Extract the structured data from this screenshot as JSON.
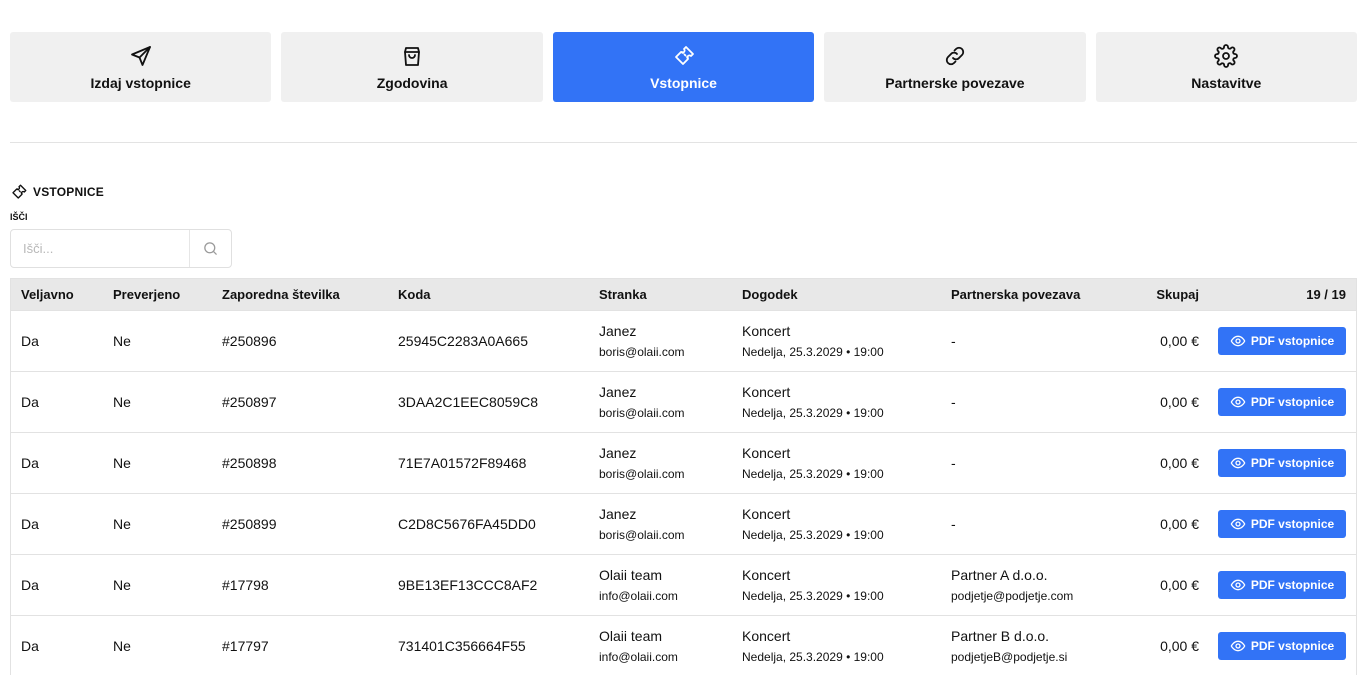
{
  "tabs": [
    {
      "label": "Izdaj vstopnice",
      "icon": "send-icon",
      "active": false
    },
    {
      "label": "Zgodovina",
      "icon": "shopping-bag-icon",
      "active": false
    },
    {
      "label": "Vstopnice",
      "icon": "ticket-icon",
      "active": true
    },
    {
      "label": "Partnerske povezave",
      "icon": "link-icon",
      "active": false
    },
    {
      "label": "Nastavitve",
      "icon": "gear-icon",
      "active": false
    }
  ],
  "section": {
    "title": "VSTOPNICE",
    "icon": "ticket-icon"
  },
  "search": {
    "label": "IŠČI",
    "placeholder": "Išči...",
    "value": "",
    "icon": "search-icon"
  },
  "table": {
    "headers": {
      "veljavno": "Veljavno",
      "preverjeno": "Preverjeno",
      "zaporedna": "Zaporedna številka",
      "koda": "Koda",
      "stranka": "Stranka",
      "dogodek": "Dogodek",
      "partnerska": "Partnerska povezava",
      "skupaj": "Skupaj",
      "count": "19 / 19"
    },
    "action_label": "PDF vstopnice",
    "action_icon": "eye-icon",
    "rows": [
      {
        "veljavno": "Da",
        "preverjeno": "Ne",
        "zaporedna": "#250896",
        "koda": "25945C2283A0A665",
        "stranka_name": "Janez",
        "stranka_email": "boris@olaii.com",
        "dogodek_name": "Koncert",
        "dogodek_date": "Nedelja, 25.3.2029 • 19:00",
        "partner_name": "-",
        "partner_email": "",
        "skupaj": "0,00 €"
      },
      {
        "veljavno": "Da",
        "preverjeno": "Ne",
        "zaporedna": "#250897",
        "koda": "3DAA2C1EEC8059C8",
        "stranka_name": "Janez",
        "stranka_email": "boris@olaii.com",
        "dogodek_name": "Koncert",
        "dogodek_date": "Nedelja, 25.3.2029 • 19:00",
        "partner_name": "-",
        "partner_email": "",
        "skupaj": "0,00 €"
      },
      {
        "veljavno": "Da",
        "preverjeno": "Ne",
        "zaporedna": "#250898",
        "koda": "71E7A01572F89468",
        "stranka_name": "Janez",
        "stranka_email": "boris@olaii.com",
        "dogodek_name": "Koncert",
        "dogodek_date": "Nedelja, 25.3.2029 • 19:00",
        "partner_name": "-",
        "partner_email": "",
        "skupaj": "0,00 €"
      },
      {
        "veljavno": "Da",
        "preverjeno": "Ne",
        "zaporedna": "#250899",
        "koda": "C2D8C5676FA45DD0",
        "stranka_name": "Janez",
        "stranka_email": "boris@olaii.com",
        "dogodek_name": "Koncert",
        "dogodek_date": "Nedelja, 25.3.2029 • 19:00",
        "partner_name": "-",
        "partner_email": "",
        "skupaj": "0,00 €"
      },
      {
        "veljavno": "Da",
        "preverjeno": "Ne",
        "zaporedna": "#17798",
        "koda": "9BE13EF13CCC8AF2",
        "stranka_name": "Olaii team",
        "stranka_email": "info@olaii.com",
        "dogodek_name": "Koncert",
        "dogodek_date": "Nedelja, 25.3.2029 • 19:00",
        "partner_name": "Partner A d.o.o.",
        "partner_email": "podjetje@podjetje.com",
        "skupaj": "0,00 €"
      },
      {
        "veljavno": "Da",
        "preverjeno": "Ne",
        "zaporedna": "#17797",
        "koda": "731401C356664F55",
        "stranka_name": "Olaii team",
        "stranka_email": "info@olaii.com",
        "dogodek_name": "Koncert",
        "dogodek_date": "Nedelja, 25.3.2029 • 19:00",
        "partner_name": "Partner B d.o.o.",
        "partner_email": "podjetjeB@podjetje.si",
        "skupaj": "0,00 €"
      }
    ]
  },
  "colors": {
    "accent": "#3273f6",
    "tab_bg": "#f0f0f0",
    "header_bg": "#e8e8e8",
    "border": "#e2e2e2"
  }
}
